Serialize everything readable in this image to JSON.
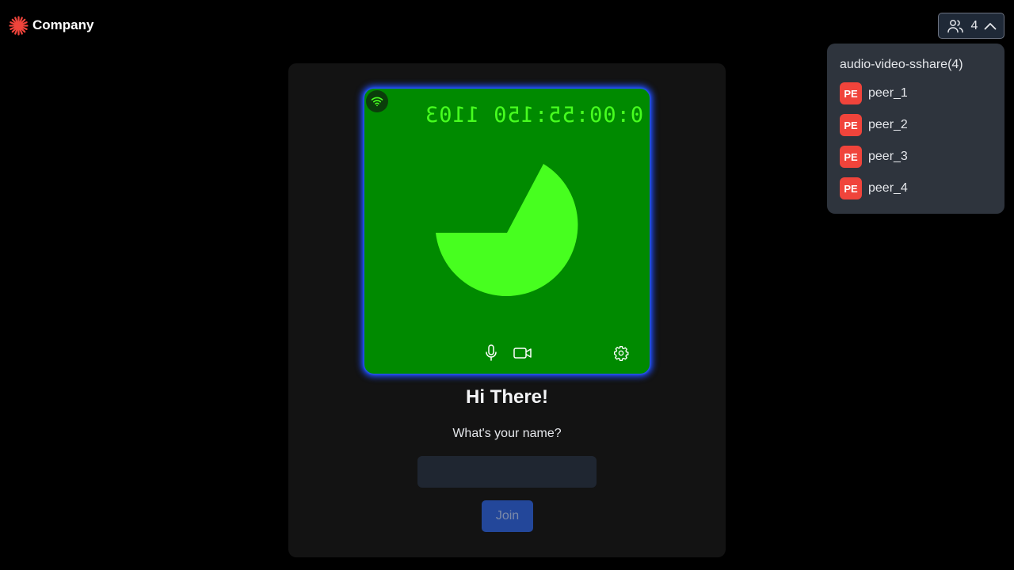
{
  "header": {
    "logo_text": "Company",
    "brand_color": "#f0443b",
    "participants_count": "4"
  },
  "participants": {
    "room_title": "audio-video-sshare(4)",
    "peers": [
      {
        "initials": "PE",
        "name": "peer_1"
      },
      {
        "initials": "PE",
        "name": "peer_2"
      },
      {
        "initials": "PE",
        "name": "peer_3"
      },
      {
        "initials": "PE",
        "name": "peer_4"
      }
    ],
    "avatar_color": "#f0443b"
  },
  "preview": {
    "timestamp": "0:00:55:150 1103",
    "tile_color": "#008a00",
    "content_color": "#47ff1f",
    "icons": {
      "signal": "wifi-icon",
      "mic": "mic-icon",
      "camera": "camera-icon",
      "settings": "gear-icon"
    }
  },
  "join_form": {
    "greeting": "Hi There!",
    "name_label": "What's your name?",
    "name_value": "",
    "join_label": "Join"
  }
}
